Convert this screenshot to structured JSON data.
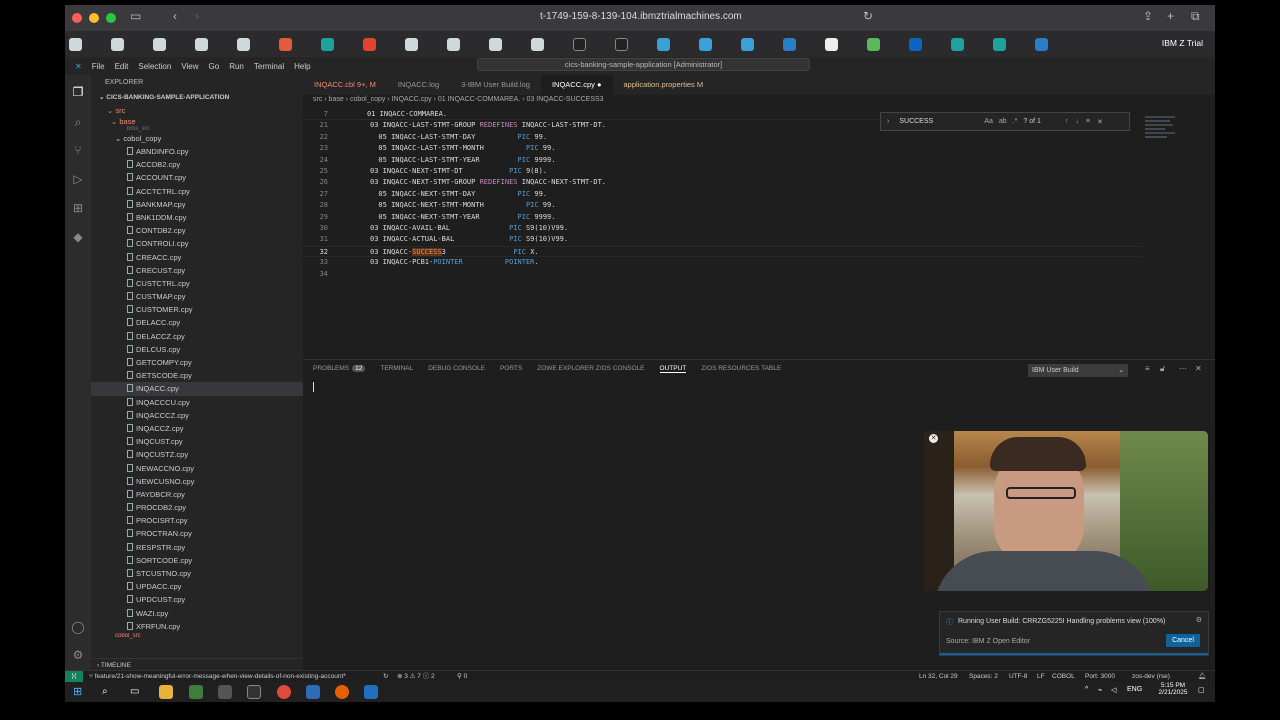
{
  "browser": {
    "url": "t-1749-159-8-139-104.ibmztrialmachines.com",
    "trial_label": "IBM Z Trial"
  },
  "menu": [
    "File",
    "Edit",
    "Selection",
    "View",
    "Go",
    "Run",
    "Terminal",
    "Help"
  ],
  "command_center": "cics-banking-sample-application [Administrator]",
  "explorer": {
    "title": "EXPLORER",
    "root": "CICS-BANKING-SAMPLE-APPLICATION",
    "src": "src",
    "base": "base",
    "bms": "bms_src",
    "copy_folder": "cobol_copy",
    "files": [
      "ABNDINFO.cpy",
      "ACCDB2.cpy",
      "ACCOUNT.cpy",
      "ACCTCTRL.cpy",
      "BANKMAP.cpy",
      "BNK1DDM.cpy",
      "CONTDB2.cpy",
      "CONTROLI.cpy",
      "CREACC.cpy",
      "CRECUST.cpy",
      "CUSTCTRL.cpy",
      "CUSTMAP.cpy",
      "CUSTOMER.cpy",
      "DELACC.cpy",
      "DELACCZ.cpy",
      "DELCUS.cpy",
      "GETCOMPY.cpy",
      "GETSCODE.cpy",
      "INQACC.cpy",
      "INQACCCU.cpy",
      "INQACCCZ.cpy",
      "INQACCZ.cpy",
      "INQCUST.cpy",
      "INQCUSTZ.cpy",
      "NEWACCNO.cpy",
      "NEWCUSNO.cpy",
      "PAYDBCR.cpy",
      "PROCDB2.cpy",
      "PROCISRT.cpy",
      "PROCTRAN.cpy",
      "RESPSTR.cpy",
      "SORTCODE.cpy",
      "STCUSTNO.cpy",
      "UPDACC.cpy",
      "UPDCUST.cpy",
      "WAZI.cpy",
      "XFRFUN.cpy"
    ],
    "next_folder": "cobol_src",
    "timeline": "TIMELINE"
  },
  "tabs": [
    {
      "label": "INQACC.cbl 9+, M",
      "active": false
    },
    {
      "label": "INQACC.log",
      "active": false
    },
    {
      "label": "3-IBM User Build.log",
      "active": false
    },
    {
      "label": "INQACC.cpy",
      "active": true
    },
    {
      "label": "application.properties M",
      "active": false
    }
  ],
  "breadcrumb": "src › base › cobol_copy › INQACC.cpy › 01 INQACC-COMMAREA. › 03 INQACC-SUCCESS3",
  "code": {
    "sticky_num": "7",
    "sticky_text": "01 INQACC-COMMAREA.",
    "lines": [
      {
        "n": "21",
        "text": "03 INQACC-LAST-STMT-GROUP REDEFINES INQACC-LAST-STMT-DT."
      },
      {
        "n": "22",
        "text": "  05 INQACC-LAST-STMT-DAY          PIC 99."
      },
      {
        "n": "23",
        "text": "  05 INQACC-LAST-STMT-MONTH          PIC 99."
      },
      {
        "n": "24",
        "text": "  05 INQACC-LAST-STMT-YEAR         PIC 9999."
      },
      {
        "n": "25",
        "text": "03 INQACC-NEXT-STMT-DT           PIC 9(8)."
      },
      {
        "n": "26",
        "text": "03 INQACC-NEXT-STMT-GROUP REDEFINES INQACC-NEXT-STMT-DT."
      },
      {
        "n": "27",
        "text": "  05 INQACC-NEXT-STMT-DAY          PIC 99."
      },
      {
        "n": "28",
        "text": "  05 INQACC-NEXT-STMT-MONTH          PIC 99."
      },
      {
        "n": "29",
        "text": "  05 INQACC-NEXT-STMT-YEAR         PIC 9999."
      },
      {
        "n": "30",
        "text": "03 INQACC-AVAIL-BAL              PIC S9(10)V99."
      },
      {
        "n": "31",
        "text": "03 INQACC-ACTUAL-BAL             PIC S9(10)V99."
      },
      {
        "n": "32",
        "text": "03 INQACC-SUCCESS3                PIC X."
      },
      {
        "n": "33",
        "text": "03 INQACC-PCB1-POINTER          POINTER."
      },
      {
        "n": "34",
        "text": ""
      }
    ]
  },
  "find": {
    "query": "SUCCESS",
    "result": "? of 1"
  },
  "panel": {
    "tabs": [
      {
        "label": "PROBLEMS",
        "badge": "12"
      },
      {
        "label": "TERMINAL"
      },
      {
        "label": "DEBUG CONSOLE"
      },
      {
        "label": "PORTS"
      },
      {
        "label": "ZOWE EXPLORER Z/OS CONSOLE"
      },
      {
        "label": "OUTPUT",
        "active": true
      },
      {
        "label": "Z/OS RESOURCES TABLE"
      }
    ],
    "output_channel": "IBM User Build"
  },
  "notification": {
    "message": "Running User Build: CRRZG5225I Handling problems view (100%)",
    "source": "Source: IBM Z Open Editor",
    "cancel": "Cancel"
  },
  "status": {
    "branch": "feature/21-show-meaningful-error-message-when-view-details-of-non-existing-account*",
    "problems": "⊗ 3 ⚠ 7 ⓘ 2",
    "ports": "0",
    "position": "Ln 32, Col 29",
    "spaces": "Spaces: 2",
    "encoding": "UTF-8",
    "eol": "LF",
    "language": "COBOL",
    "port": "Port: 3000",
    "profile": "zos-dev (rse)"
  },
  "taskbar": {
    "time": "5:15 PM",
    "date": "2/21/2025",
    "lang": "ENG"
  },
  "colors": {
    "accent": "#0e639c",
    "remote": "#16825d",
    "highlight": "#613214"
  }
}
